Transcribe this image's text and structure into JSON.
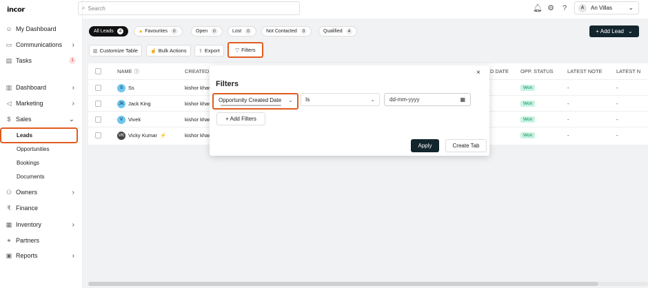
{
  "brand": {
    "logo_text": "incor"
  },
  "sidebar": {
    "items": [
      {
        "label": "My Dashboard",
        "icon": "person-icon"
      },
      {
        "label": "Communications",
        "icon": "chat-icon",
        "chevron": "›"
      },
      {
        "label": "Tasks",
        "icon": "calendar-icon",
        "badge": "1"
      },
      {
        "label": "Dashboard",
        "icon": "bar-chart-icon",
        "chevron": "›"
      },
      {
        "label": "Marketing",
        "icon": "megaphone-icon",
        "chevron": "›"
      },
      {
        "label": "Sales",
        "icon": "dollar-icon",
        "chevron": "⌄"
      },
      {
        "label": "Owners",
        "icon": "people-icon",
        "chevron": "›"
      },
      {
        "label": "Finance",
        "icon": "rupee-icon"
      },
      {
        "label": "Inventory",
        "icon": "box-icon",
        "chevron": "›"
      },
      {
        "label": "Partners",
        "icon": "handshake-icon"
      },
      {
        "label": "Reports",
        "icon": "report-icon",
        "chevron": "›"
      }
    ],
    "sales_sub": [
      "Leads",
      "Opportunities",
      "Bookings",
      "Documents"
    ]
  },
  "topbar": {
    "search_placeholder": "Search",
    "account_initial": "A",
    "account_name": "An Villas"
  },
  "tabs": [
    {
      "label": "All Leads",
      "count": "4",
      "active": true
    },
    {
      "label": "Favourites",
      "count": "0",
      "star": true
    },
    {
      "label": "Open",
      "count": "0"
    },
    {
      "label": "Lost",
      "count": "0"
    },
    {
      "label": "Not Contacted",
      "count": "0"
    },
    {
      "label": "Qualified",
      "count": "4"
    }
  ],
  "add_lead_label": "+ Add Lead",
  "toolbar": {
    "customize": "Customize Table",
    "bulk": "Bulk Actions",
    "export": "Export",
    "filters": "Filters"
  },
  "table": {
    "headers": {
      "name": "NAME",
      "created": "CREATED",
      "d_date": "D DATE",
      "opp_status": "OPP. STATUS",
      "latest_note": "LATEST NOTE",
      "latest_n": "LATEST N"
    },
    "rows": [
      {
        "initials": "S",
        "name": "Ss",
        "created": "kishor khar",
        "status": "Won",
        "note": "-",
        "note2": "-"
      },
      {
        "initials": "JK",
        "name": "Jack King",
        "created": "kishor khar",
        "status": "Won",
        "note": "-",
        "note2": "-"
      },
      {
        "initials": "V",
        "name": "Vivek",
        "created": "kishor khar",
        "status": "Won",
        "note": "-",
        "note2": "-"
      },
      {
        "initials": "VK",
        "name": "Vicky Kumar",
        "created": "kishor khar",
        "status": "Won",
        "note": "-",
        "note2": "-",
        "flash": true
      }
    ]
  },
  "filters_modal": {
    "title": "Filters",
    "close": "×",
    "field_value": "Opportunity Created Date",
    "operator_value": "Is",
    "date_placeholder": "dd-mm-yyyy",
    "add_filters_label": "+ Add Filters",
    "apply_label": "Apply",
    "create_tab_label": "Create Tab"
  },
  "colors": {
    "accent": "#13252d",
    "highlight": "#e05a1e",
    "won_bg": "#c9f3e1"
  }
}
